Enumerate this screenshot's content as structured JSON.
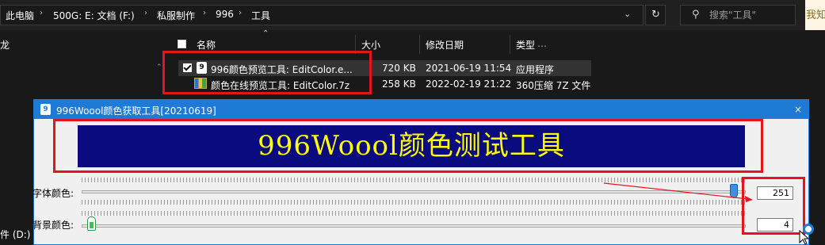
{
  "breadcrumb": [
    "此电脑",
    "500G: E: 文档 (F:)",
    "私服制作",
    "996",
    "工具"
  ],
  "search": {
    "placeholder": "搜索\"工具\""
  },
  "right_strip_text": "我知",
  "nav": {
    "item_top": "龙",
    "item_bottom": "件 (D:)"
  },
  "columns": {
    "name": "名称",
    "size": "大小",
    "date": "修改日期",
    "type": "类型"
  },
  "files": [
    {
      "name": "996颜色预览工具: EditColor.e...",
      "size": "720 KB",
      "date": "2021-06-19 11:54",
      "type": "应用程序",
      "selected": true,
      "icon": "app-exe-icon"
    },
    {
      "name": "颜色在线预览工具: EditColor.7z",
      "size": "258 KB",
      "date": "2022-02-19 21:22",
      "type": "360压缩 7Z 文件",
      "selected": false,
      "icon": "archive-7z-icon"
    }
  ],
  "app": {
    "title": "996Woool颜色获取工具[20210619]",
    "banner_text": "996Woool颜色测试工具",
    "font_color_label": "字体颜色:",
    "bg_color_label": "背景颜色:",
    "font_color_value": "251",
    "bg_color_value": "4",
    "font_color_slider_fraction": 0.98,
    "bg_color_slider_fraction": 0.016,
    "banner_bg": "#0b0b80",
    "banner_fg": "#ffff00",
    "close_icon": "×"
  },
  "colors": {
    "accent": "#1f7ad6",
    "highlight": "#e3141c"
  }
}
